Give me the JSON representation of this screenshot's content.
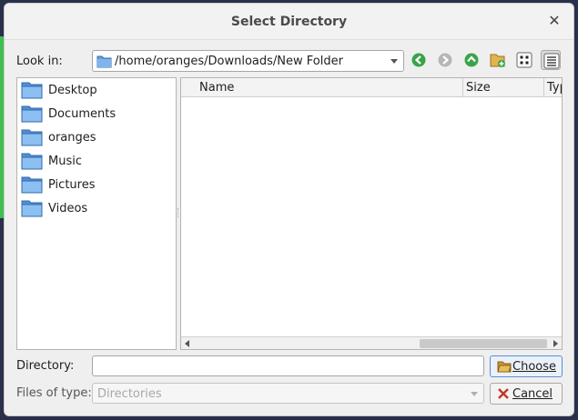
{
  "dialog": {
    "title": "Select Directory",
    "close_icon": "close-icon"
  },
  "toolbar": {
    "look_in_label": "Look in:",
    "path": "/home/oranges/Downloads/New Folder",
    "buttons": [
      "back-icon",
      "forward-icon",
      "parent-directory-icon",
      "new-folder-icon",
      "list-view-icon",
      "detail-view-icon"
    ],
    "active_view": "detail-view-icon"
  },
  "sidebar": {
    "items": [
      {
        "label": "Desktop"
      },
      {
        "label": "Documents"
      },
      {
        "label": "oranges"
      },
      {
        "label": "Music"
      },
      {
        "label": "Pictures"
      },
      {
        "label": "Videos"
      }
    ]
  },
  "file_list": {
    "columns": [
      "Name",
      "Size",
      "Typ"
    ],
    "rows": []
  },
  "footer": {
    "directory_label": "Directory:",
    "directory_value": "",
    "files_of_type_label": "Files of type:",
    "files_of_type_value": "Directories",
    "choose_label": "Choose",
    "cancel_label": "Cancel"
  },
  "colors": {
    "accent": "#5b8fd0",
    "nav_green": "#3aa34a",
    "folder_blue": "#5f9ee0"
  }
}
